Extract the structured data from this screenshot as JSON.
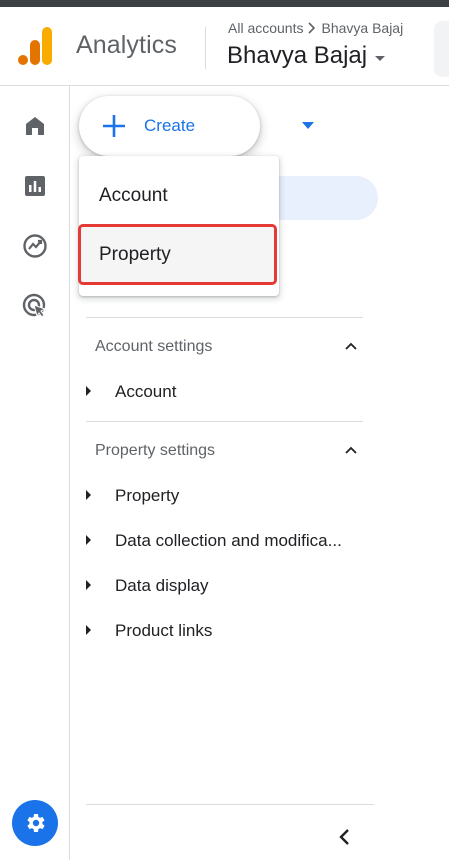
{
  "header": {
    "app_title": "Analytics",
    "breadcrumb_root": "All accounts",
    "breadcrumb_account": "Bhavya Bajaj",
    "account_name": "Bhavya Bajaj"
  },
  "nav_rail": {
    "items": [
      {
        "icon": "home-icon",
        "label": "Home"
      },
      {
        "icon": "reports-icon",
        "label": "Reports"
      },
      {
        "icon": "explore-icon",
        "label": "Explore"
      },
      {
        "icon": "advertising-icon",
        "label": "Advertising"
      }
    ],
    "settings_icon": "gear-icon"
  },
  "create_button": {
    "label": "Create"
  },
  "create_menu": {
    "items": [
      {
        "label": "Account"
      },
      {
        "label": "Property"
      }
    ]
  },
  "sections": {
    "account_settings": {
      "title": "Account settings",
      "items": [
        {
          "label": "Account"
        }
      ]
    },
    "property_settings": {
      "title": "Property settings",
      "items": [
        {
          "label": "Property"
        },
        {
          "label": "Data collection and modifica..."
        },
        {
          "label": "Data display"
        },
        {
          "label": "Product links"
        }
      ]
    }
  },
  "colors": {
    "accent": "#1a73e8",
    "highlight": "#e8f0fe",
    "annotation": "#e53935",
    "logo_orange": "#f9ab00",
    "logo_dark_orange": "#e37400"
  }
}
